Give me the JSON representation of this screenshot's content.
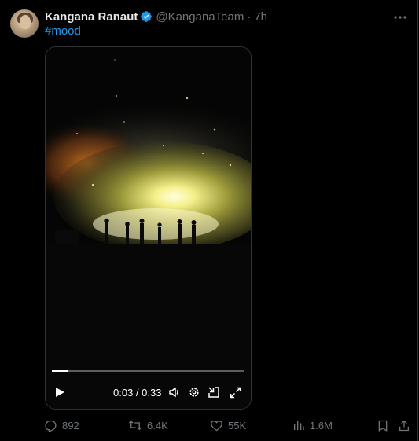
{
  "author": {
    "name": "Kangana Ranaut",
    "handle": "@KanganaTeam",
    "separator": "·",
    "time": "7h"
  },
  "tweet": {
    "text": "#mood"
  },
  "video": {
    "time_display": "0:03 / 0:33",
    "progress": 0.08
  },
  "actions": {
    "replies": "892",
    "reposts": "6.4K",
    "likes": "55K",
    "views": "1.6M"
  },
  "colors": {
    "accent": "#1d9bf0",
    "muted": "#71767b",
    "background": "#000000",
    "border": "#2f3336"
  },
  "icons": [
    "verified-badge-icon",
    "more-icon",
    "play-icon",
    "volume-icon",
    "settings-icon",
    "minimize-icon",
    "fullscreen-icon",
    "reply-icon",
    "repost-icon",
    "like-icon",
    "views-icon",
    "bookmark-icon",
    "share-icon"
  ]
}
